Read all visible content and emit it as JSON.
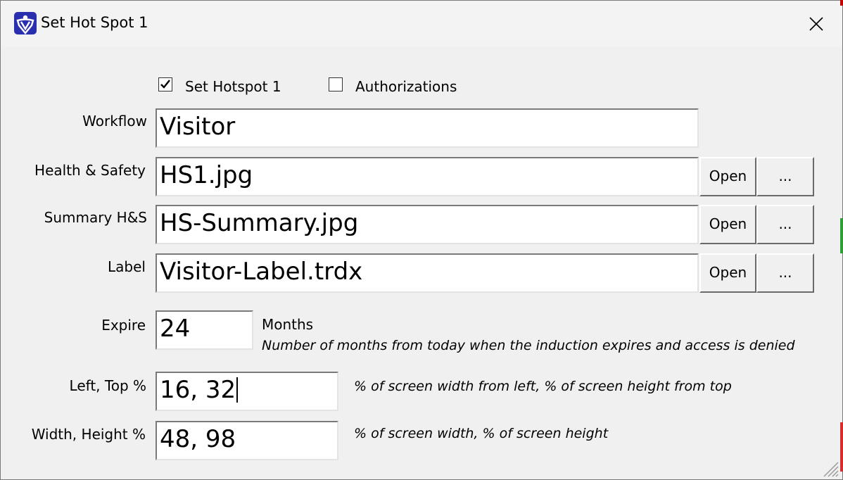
{
  "window": {
    "title": "Set Hot Spot 1",
    "app_icon": "shield-logo-icon",
    "close_icon": "close-icon",
    "resize_grip_icon": "resize-grip-icon"
  },
  "checkboxes": {
    "set_hotspot": {
      "label": "Set Hotspot 1",
      "checked": true
    },
    "authorizations": {
      "label": "Authorizations",
      "checked": false
    }
  },
  "form": {
    "workflow": {
      "label": "Workflow",
      "value": "Visitor"
    },
    "health_safety": {
      "label": "Health & Safety",
      "value": "HS1.jpg",
      "open_label": "Open",
      "browse_label": "..."
    },
    "summary_hs": {
      "label": "Summary H&S",
      "value": "HS-Summary.jpg",
      "open_label": "Open",
      "browse_label": "..."
    },
    "label_file": {
      "label": "Label",
      "value": "Visitor-Label.trdx",
      "open_label": "Open",
      "browse_label": "..."
    },
    "expire": {
      "label": "Expire",
      "value": "24",
      "unit": "Months",
      "hint": "Number of months from today when the induction expires and access is denied"
    },
    "left_top": {
      "label": "Left, Top %",
      "value": "16, 32",
      "hint": "% of screen width from left, % of screen height from top"
    },
    "width_height": {
      "label": "Width, Height %",
      "value": "48, 98",
      "hint": "% of screen width, % of screen height"
    }
  },
  "colors": {
    "window_bg": "#f0f0f0",
    "app_icon_bg": "#2a2fb0"
  }
}
